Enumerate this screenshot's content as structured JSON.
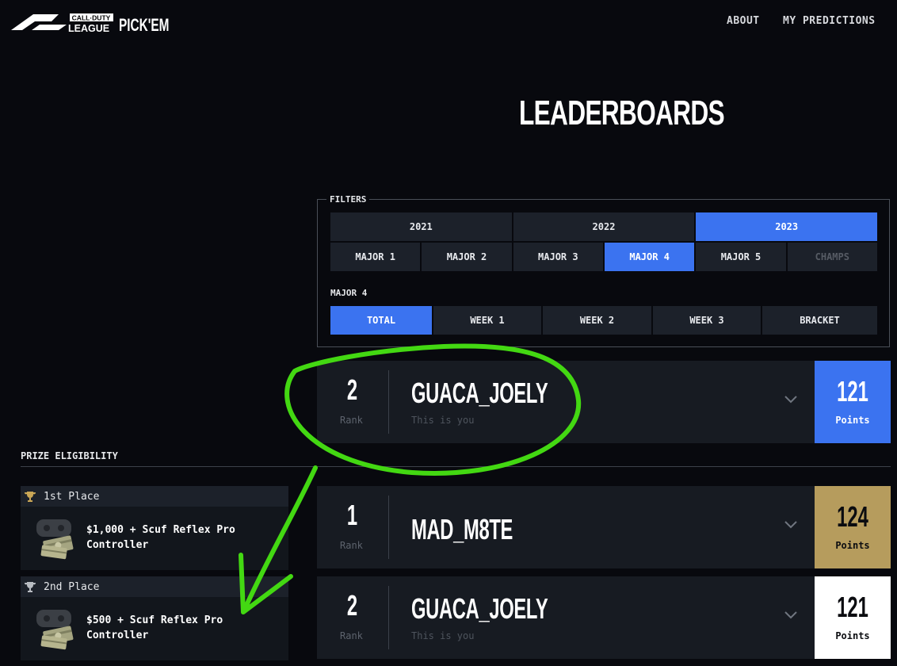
{
  "header": {
    "logo_top": "CALL·DUTY",
    "logo_bottom": "LEAGUE",
    "logo_suffix": "PICK'EM",
    "nav": [
      {
        "label": "ABOUT"
      },
      {
        "label": "MY PREDICTIONS"
      }
    ]
  },
  "page_title": "LEADERBOARDS",
  "filters": {
    "legend": "FILTERS",
    "years": [
      {
        "label": "2021",
        "active": false
      },
      {
        "label": "2022",
        "active": false
      },
      {
        "label": "2023",
        "active": true
      }
    ],
    "majors": [
      {
        "label": "MAJOR 1",
        "active": false
      },
      {
        "label": "MAJOR 2",
        "active": false
      },
      {
        "label": "MAJOR 3",
        "active": false
      },
      {
        "label": "MAJOR 4",
        "active": true
      },
      {
        "label": "MAJOR 5",
        "active": false
      },
      {
        "label": "CHAMPS",
        "active": false,
        "disabled": true
      }
    ],
    "selected_major_label": "MAJOR 4",
    "weeks": [
      {
        "label": "TOTAL",
        "active": true
      },
      {
        "label": "WEEK 1",
        "active": false
      },
      {
        "label": "WEEK 2",
        "active": false
      },
      {
        "label": "WEEK 3",
        "active": false
      },
      {
        "label": "BRACKET",
        "active": false
      }
    ]
  },
  "user_row": {
    "rank": "2",
    "rank_label": "Rank",
    "name": "GUACA_JOELY",
    "subtitle": "This is you",
    "points": "121",
    "points_label": "Points",
    "points_bg": "#3b73f0",
    "points_color": "#ffffff"
  },
  "leaderboard": [
    {
      "rank": "1",
      "rank_label": "Rank",
      "name": "MAD_M8TE",
      "subtitle": "",
      "points": "124",
      "points_label": "Points",
      "points_bg": "#b69c5d",
      "points_color": "#0b0c10"
    },
    {
      "rank": "2",
      "rank_label": "Rank",
      "name": "GUACA_JOELY",
      "subtitle": "This is you",
      "points": "121",
      "points_label": "Points",
      "points_bg": "#ffffff",
      "points_color": "#0b0c10"
    }
  ],
  "prize": {
    "title": "PRIZE ELIGIBILITY",
    "items": [
      {
        "place": "1st Place",
        "reward": "$1,000 + Scuf Reflex Pro Controller",
        "trophy_color": "#c9a656",
        "icon": "controller-cash-icon"
      },
      {
        "place": "2nd Place",
        "reward": "$500 + Scuf Reflex Pro Controller",
        "trophy_color": "#b8bcc2",
        "icon": "controller-cash-icon"
      }
    ]
  },
  "annotation": {
    "stroke_color": "#43d812"
  }
}
